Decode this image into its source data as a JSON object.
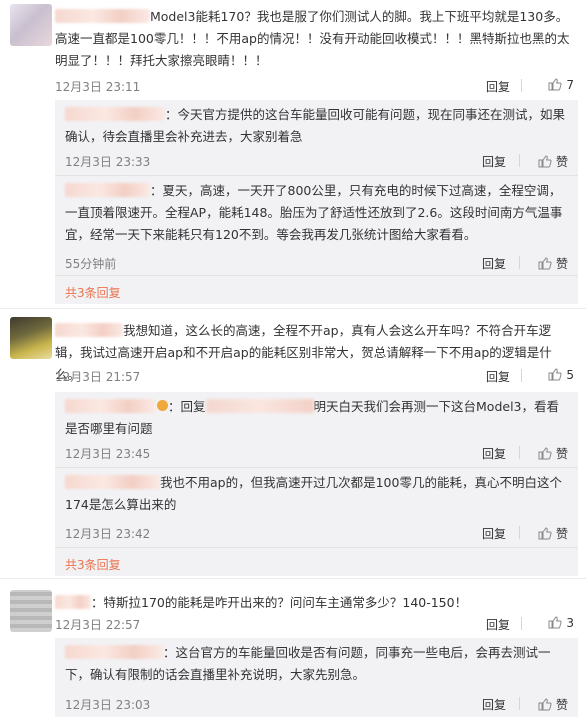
{
  "threads": [
    {
      "text": "Model3能耗170？我也是服了你们测试人的脚。我上下班平均就是130多。高速一直都是100零几！！！不用ap的情况！！没有开动能回收模式！！！黑特斯拉也黑的太明显了！！！拜托大家擦亮眼睛！！！",
      "time": "12月3日 23:11",
      "reply": "回复",
      "likes": "7",
      "replies": [
        {
          "text": "：今天官方提供的这台车能量回收可能有问题，现在同事还在测试，如果确认，待会直播里会补充进去，大家别着急",
          "time": "12月3日 23:33",
          "reply": "回复",
          "likes": "赞"
        },
        {
          "text": "：夏天，高速，一天开了800公里，只有充电的时候下过高速，全程空调，一直顶着限速开。全程AP，能耗148。胎压为了舒适性还放到了2.6。这段时间南方气温事宜，经常一天下来能耗只有120不到。等会我再发几张统计图给大家看看。",
          "time": "55分钟前",
          "reply": "回复",
          "likes": "赞"
        }
      ],
      "more": "共3条回复"
    },
    {
      "text": "我想知道，这么长的高速，全程不开ap，真有人会这么开车吗？不符合开车逻辑，我试过高速开启ap和不开启ap的能耗区别非常大，贺总请解释一下不用ap的逻辑是什么。",
      "time": "12月3日 21:57",
      "reply": "回复",
      "likes": "5",
      "replies": [
        {
          "text_a": "：回复",
          "text_b": "明天白天我们会再测一下这台Model3，看看是否哪里有问题",
          "time": "12月3日 23:45",
          "reply": "回复",
          "likes": "赞"
        },
        {
          "text": "我也不用ap的，但我高速开过几次都是100零几的能耗，真心不明白这个174是怎么算出来的",
          "time": "12月3日 23:42",
          "reply": "回复",
          "likes": "赞"
        }
      ],
      "more": "共3条回复"
    },
    {
      "text": "：特斯拉170的能耗是咋开出来的？问问车主通常多少？140-150！",
      "time": "12月3日 22:57",
      "reply": "回复",
      "likes": "3",
      "replies": [
        {
          "text": "：这台官方的车能量回收是否有问题，同事充一些电后，会再去测试一下，确认有限制的话会直播里补充说明，大家先别急。",
          "time": "12月3日 23:03",
          "reply": "回复",
          "likes": "赞"
        }
      ]
    }
  ],
  "colors": {
    "link": "#eb7350",
    "text": "#333333",
    "meta": "#808080",
    "subbg": "#f2f2f5"
  },
  "icons": {
    "like": "thumbs-up-icon",
    "vip": "vip-badge-icon"
  }
}
